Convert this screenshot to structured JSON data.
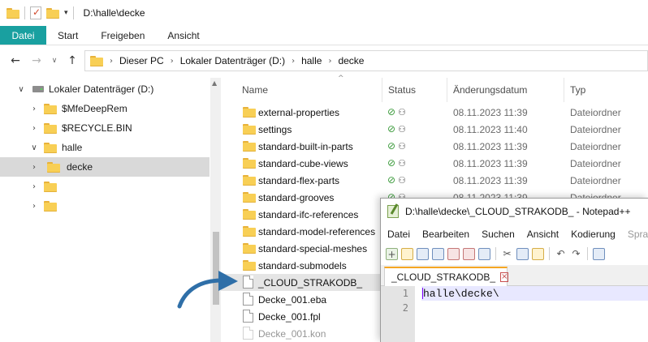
{
  "window": {
    "title": "D:\\halle\\decke"
  },
  "ribbon": {
    "tabs": [
      "Datei",
      "Start",
      "Freigeben",
      "Ansicht"
    ]
  },
  "address": {
    "crumbs": [
      "Dieser PC",
      "Lokaler Datenträger (D:)",
      "halle",
      "decke"
    ]
  },
  "nav": {
    "items": [
      {
        "label": "Lokaler Datenträger (D:)"
      },
      {
        "label": "$MfeDeepRem"
      },
      {
        "label": "$RECYCLE.BIN"
      },
      {
        "label": "halle"
      },
      {
        "label": "decke"
      },
      {
        "label": ""
      },
      {
        "label": ""
      }
    ]
  },
  "columns": {
    "name": "Name",
    "status": "Status",
    "date": "Änderungsdatum",
    "type": "Typ"
  },
  "files": [
    {
      "name": "external-properties",
      "date": "08.11.2023 11:39",
      "type": "Dateiordner"
    },
    {
      "name": "settings",
      "date": "08.11.2023 11:40",
      "type": "Dateiordner"
    },
    {
      "name": "standard-built-in-parts",
      "date": "08.11.2023 11:39",
      "type": "Dateiordner"
    },
    {
      "name": "standard-cube-views",
      "date": "08.11.2023 11:39",
      "type": "Dateiordner"
    },
    {
      "name": "standard-flex-parts",
      "date": "08.11.2023 11:39",
      "type": "Dateiordner"
    },
    {
      "name": "standard-grooves",
      "date": "08.11.2023 11:39",
      "type": "Dateiordner"
    },
    {
      "name": "standard-ifc-references"
    },
    {
      "name": "standard-model-references"
    },
    {
      "name": "standard-special-meshes"
    },
    {
      "name": "standard-submodels"
    },
    {
      "name": "_CLOUD_STRAKODB_"
    },
    {
      "name": "Decke_001.eba"
    },
    {
      "name": "Decke_001.fpl"
    },
    {
      "name": "Decke_001.kon"
    }
  ],
  "notepad": {
    "title": "D:\\halle\\decke\\_CLOUD_STRAKODB_ - Notepad++",
    "menu": [
      "Datei",
      "Bearbeiten",
      "Suchen",
      "Ansicht",
      "Kodierung",
      "Sprac"
    ],
    "tab": "_CLOUD_STRAKODB_",
    "lines": [
      "1",
      "2"
    ],
    "content": "halle\\decke\\"
  },
  "colors": {
    "accent": "#19a0a0",
    "folder": "#f8cf55",
    "status_ok": "#3a9a3a",
    "arrow": "#2f6fa8"
  }
}
